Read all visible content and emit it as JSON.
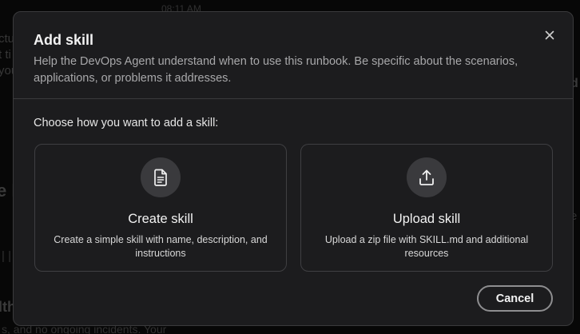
{
  "background": {
    "time": "08:11 AM",
    "line1": "ctu",
    "line2": "t ti",
    "line3": "you",
    "heading1": "e l",
    "bar": "| |",
    "heading2": "lth",
    "bottom_text": "s, and no ongoing incidents. Your",
    "right1": "d",
    "right2": "e"
  },
  "modal": {
    "title": "Add skill",
    "description": "Help the DevOps Agent understand when to use this runbook. Be specific about the scenarios, applications, or problems it addresses.",
    "close_icon": "close-icon",
    "prompt": "Choose how you want to add a skill:",
    "options": [
      {
        "icon": "document-icon",
        "title": "Create skill",
        "description": "Create a simple skill with name, description, and instructions"
      },
      {
        "icon": "upload-icon",
        "title": "Upload skill",
        "description": "Upload a zip file with SKILL.md and additional resources"
      }
    ],
    "cancel_label": "Cancel"
  },
  "colors": {
    "modal_bg": "#1c1c1e",
    "border": "#3a3a3c",
    "icon_circle": "#3a3a3d"
  }
}
